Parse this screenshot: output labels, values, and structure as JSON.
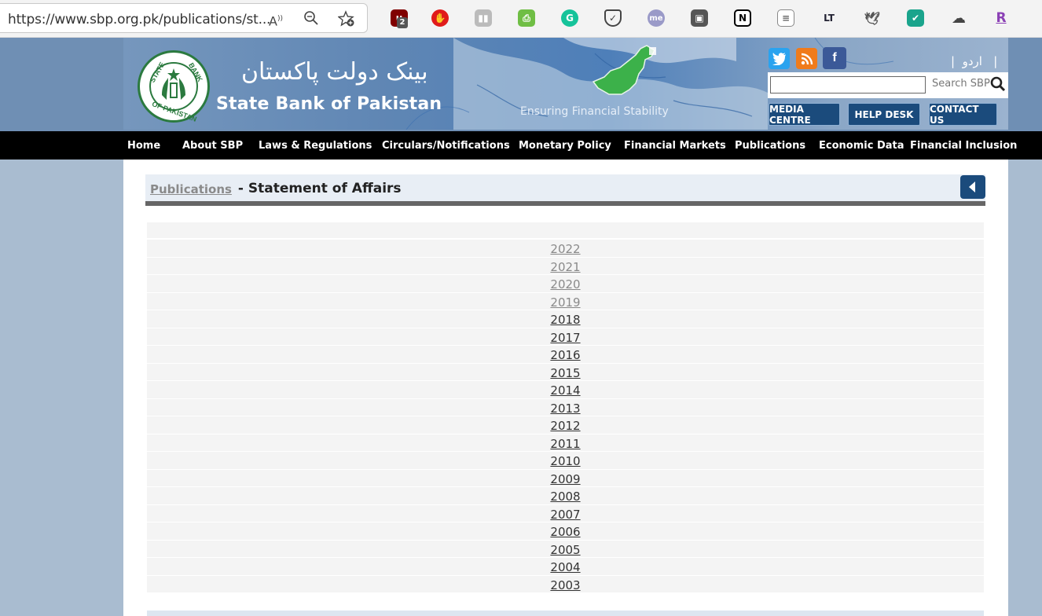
{
  "browser": {
    "url": "https://www.sbp.org.pk/publications/st...",
    "extensions": [
      "ublock-icon",
      "adblock-icon",
      "reader-icon",
      "print-icon",
      "grammarly-icon",
      "pocket-icon",
      "me-icon",
      "screenshot-icon",
      "notion-icon",
      "document-icon",
      "languagetool-icon",
      "bird-icon",
      "todoist-icon",
      "cloud-icon",
      "r-icon"
    ],
    "ublock_badge": "2"
  },
  "header": {
    "urdu_title": "بینک دولت پاکستان",
    "bank_name": "State Bank of Pakistan",
    "tagline": "Ensuring Financial Stability",
    "urdu_link": "اردو",
    "search_placeholder": "",
    "search_label": "Search SBP",
    "buttons": [
      "MEDIA CENTRE",
      "HELP DESK",
      "CONTACT US"
    ],
    "social": [
      "twitter-icon",
      "rss-icon",
      "facebook-icon"
    ],
    "logo_text_top": "STATE BANK",
    "logo_text_bottom": "OF PAKISTAN"
  },
  "nav": {
    "items": [
      "Home",
      "About SBP",
      "Laws & Regulations",
      "Circulars/Notifications",
      "Monetary Policy",
      "Financial Markets",
      "Publications",
      "Economic Data",
      "Financial Inclusion"
    ]
  },
  "page": {
    "breadcrumb": "Publications",
    "separator": " - ",
    "title": "Statement of Affairs"
  },
  "years": [
    {
      "label": "2022",
      "visited": true
    },
    {
      "label": "2021",
      "visited": true
    },
    {
      "label": "2020",
      "visited": true
    },
    {
      "label": "2019",
      "visited": true
    },
    {
      "label": "2018",
      "visited": false
    },
    {
      "label": "2017",
      "visited": false
    },
    {
      "label": "2016",
      "visited": false
    },
    {
      "label": "2015",
      "visited": false
    },
    {
      "label": "2014",
      "visited": false
    },
    {
      "label": "2013",
      "visited": false
    },
    {
      "label": "2012",
      "visited": false
    },
    {
      "label": "2011",
      "visited": false
    },
    {
      "label": "2010",
      "visited": false
    },
    {
      "label": "2009",
      "visited": false
    },
    {
      "label": "2008",
      "visited": false
    },
    {
      "label": "2007",
      "visited": false
    },
    {
      "label": "2006",
      "visited": false
    },
    {
      "label": "2005",
      "visited": false
    },
    {
      "label": "2004",
      "visited": false
    },
    {
      "label": "2003",
      "visited": false
    }
  ],
  "colors": {
    "nav_bg": "#000000",
    "button_bg": "#1b4b7c",
    "link_visited": "#8a8a8a",
    "link": "#333333"
  }
}
